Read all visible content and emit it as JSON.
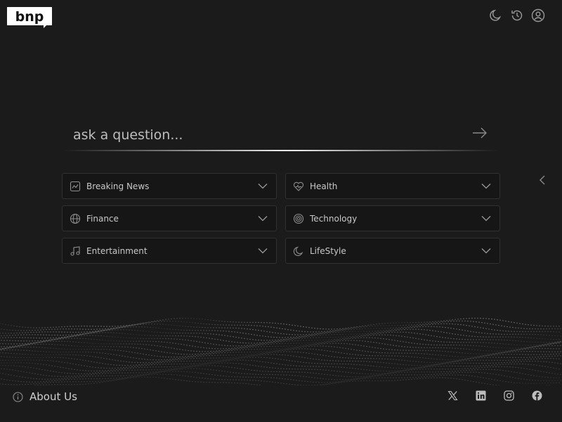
{
  "brand": {
    "logo_text": "bnp"
  },
  "header": {
    "icons": [
      "moon-icon",
      "history-icon",
      "user-icon"
    ]
  },
  "search": {
    "placeholder": "ask a question...",
    "submit_icon": "arrow-right-icon"
  },
  "categories": [
    {
      "label": "Breaking News",
      "icon": "trend-chart-icon"
    },
    {
      "label": "Health",
      "icon": "heart-icon"
    },
    {
      "label": "Finance",
      "icon": "globe-icon"
    },
    {
      "label": "Technology",
      "icon": "chip-icon"
    },
    {
      "label": "Entertainment",
      "icon": "music-icon"
    },
    {
      "label": "LifeStyle",
      "icon": "moon-icon"
    }
  ],
  "side_toggle_icon": "chevron-left-icon",
  "footer": {
    "about_label": "About Us",
    "socials": [
      "x-icon",
      "linkedin-icon",
      "instagram-icon",
      "facebook-icon"
    ]
  },
  "colors": {
    "background": "#1b1b1b",
    "card_background": "#161616",
    "card_border": "#303030",
    "text": "#c8c8c8"
  }
}
